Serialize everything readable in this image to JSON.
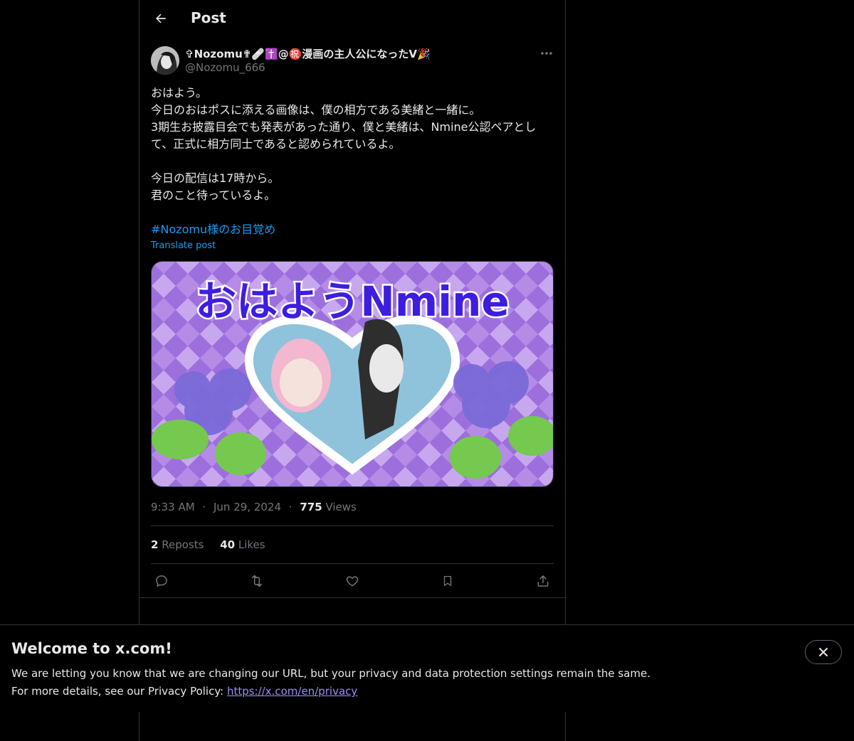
{
  "header": {
    "title": "Post"
  },
  "author": {
    "display_name": "✞Nozomu✟🩹✝️@㊗️漫画の主人公になったV🎉",
    "handle": "@Nozomu_666"
  },
  "post": {
    "text": "おはよう。\n今日のおはポスに添える画像は、僕の相方である美緒と一緒に。\n3期生お披露目会でも発表があった通り、僕と美緒は、Nmine公認ペアとして、正式に相方同士であると認められているよ。\n\n今日の配信は17時から。\n君のこと待っているよ。",
    "hashtag": "#Nozomu様のお目覚め",
    "translate_label": "Translate post",
    "image_text": "おはようNmine",
    "time": "9:33 AM",
    "date": "Jun 29, 2024",
    "views_count": "775",
    "views_label": "Views",
    "separator": "·"
  },
  "stats": {
    "reposts_count": "2",
    "reposts_label": "Reposts",
    "likes_count": "40",
    "likes_label": "Likes"
  },
  "actions": [
    "reply-icon",
    "repost-icon",
    "like-icon",
    "bookmark-icon",
    "share-icon"
  ],
  "banner": {
    "title": "Welcome to x.com!",
    "line1": "We are letting you know that we are changing our URL, but your privacy and data protection settings remain the same.",
    "line2_prefix": "For more details, see our Privacy Policy: ",
    "link": "https://x.com/en/privacy"
  },
  "colors": {
    "background": "#000000",
    "text": "#e7e9ea",
    "secondary": "#71767b",
    "link": "#1d9bf0",
    "border": "#2f3336",
    "image_purple": "#a77bdc"
  }
}
